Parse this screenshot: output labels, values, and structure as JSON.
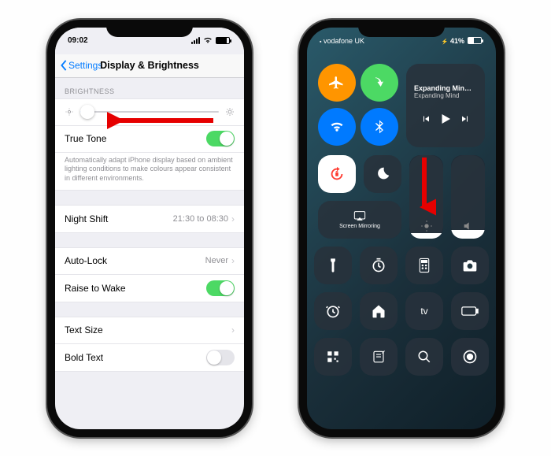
{
  "left": {
    "status": {
      "time": "09:02"
    },
    "nav": {
      "back": "Settings",
      "title": "Display & Brightness"
    },
    "brightness_header": "BRIGHTNESS",
    "true_tone": {
      "label": "True Tone",
      "desc": "Automatically adapt iPhone display based on ambient lighting conditions to make colours appear consistent in different environments."
    },
    "night_shift": {
      "label": "Night Shift",
      "detail": "21:30 to 08:30"
    },
    "auto_lock": {
      "label": "Auto-Lock",
      "detail": "Never"
    },
    "raise_to_wake": {
      "label": "Raise to Wake"
    },
    "text_size": {
      "label": "Text Size"
    },
    "bold_text": {
      "label": "Bold Text"
    }
  },
  "right": {
    "status": {
      "carrier": "vodafone UK",
      "battery": "41%"
    },
    "media": {
      "title": "Expanding Min…",
      "subtitle": "Expanding Mind"
    },
    "mirror": "Screen Mirroring"
  }
}
